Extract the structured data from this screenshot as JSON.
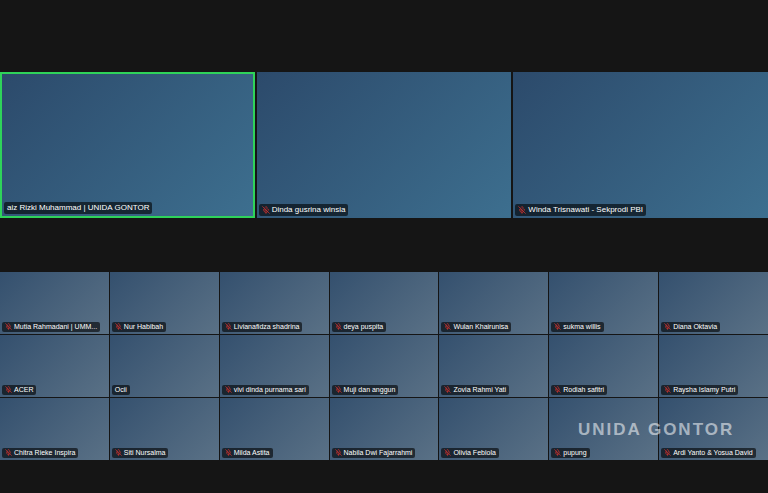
{
  "speakers": [
    {
      "name": "aiz Rizki Muhammad | UNIDA GONTOR",
      "muted": false,
      "speaking": true
    },
    {
      "name": "Dinda gusrina winsia",
      "muted": true,
      "speaking": false
    },
    {
      "name": "Winda Trisnawati - Sekprodi PBI",
      "muted": true,
      "speaking": false
    }
  ],
  "gallery": [
    {
      "name": "Mutia Rahmadani | UMM...",
      "muted": true
    },
    {
      "name": "Nur Habibah",
      "muted": true
    },
    {
      "name": "Livianafidza shadrina",
      "muted": true
    },
    {
      "name": "deya puspita",
      "muted": true
    },
    {
      "name": "Wulan Khairunisa",
      "muted": true
    },
    {
      "name": "sukma willis",
      "muted": true
    },
    {
      "name": "Diana Oktavia",
      "muted": true
    },
    {
      "name": "ACER",
      "muted": true
    },
    {
      "name": "Ocii",
      "muted": false
    },
    {
      "name": "vivi dinda purnama sari",
      "muted": true
    },
    {
      "name": "Muji dan anggun",
      "muted": true
    },
    {
      "name": "Zovia Rahmi Yati",
      "muted": true
    },
    {
      "name": "Rodiah safitri",
      "muted": true
    },
    {
      "name": "Raysha Islamy Putri",
      "muted": true
    },
    {
      "name": "Chitra Rieke Inspira",
      "muted": true
    },
    {
      "name": "Siti Nursalma",
      "muted": true
    },
    {
      "name": "Milda Astita",
      "muted": true
    },
    {
      "name": "Nabila Dwi Fajarrahmi",
      "muted": true
    },
    {
      "name": "Olivia Febiola",
      "muted": true
    },
    {
      "name": "pupung",
      "muted": true
    },
    {
      "name": "Ardi Yanto & Yosua David",
      "muted": true
    }
  ],
  "watermark": "UNIDA GONTOR"
}
